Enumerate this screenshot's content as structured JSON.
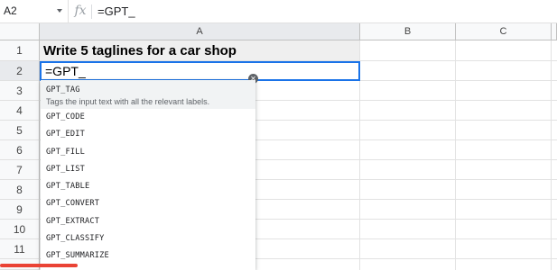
{
  "formula_bar": {
    "cell_ref": "A2",
    "fx": "fx",
    "formula": "=GPT_"
  },
  "columns": [
    "A",
    "B",
    "C"
  ],
  "rows": [
    "1",
    "2",
    "3",
    "4",
    "5",
    "6",
    "7",
    "8",
    "9",
    "10",
    "11"
  ],
  "cells": {
    "A1": "Write 5 taglines for a car shop",
    "A2": "=GPT_"
  },
  "autocomplete": {
    "items": [
      {
        "name": "GPT_TAG",
        "description": "Tags the input text with all the relevant labels."
      },
      {
        "name": "GPT_CODE"
      },
      {
        "name": "GPT_EDIT"
      },
      {
        "name": "GPT_FILL"
      },
      {
        "name": "GPT_LIST"
      },
      {
        "name": "GPT_TABLE"
      },
      {
        "name": "GPT_CONVERT"
      },
      {
        "name": "GPT_EXTRACT"
      },
      {
        "name": "GPT_CLASSIFY"
      },
      {
        "name": "GPT_SUMMARIZE"
      }
    ],
    "close_icon": "close-icon"
  },
  "colors": {
    "selection": "#1a73e8",
    "header_bg": "#f8f9fa",
    "accent_bar": "#ea4335"
  }
}
